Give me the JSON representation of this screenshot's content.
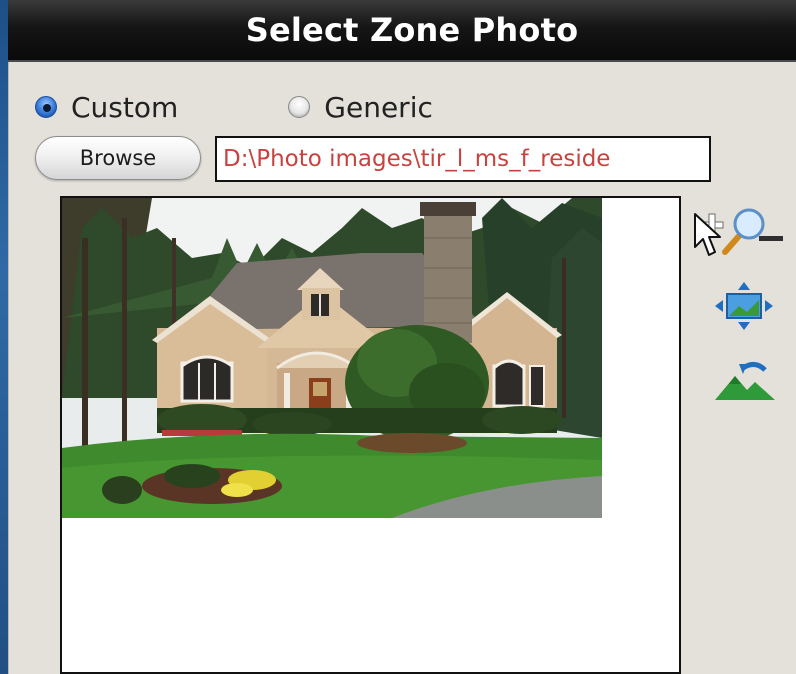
{
  "window": {
    "title": "Select Zone Photo"
  },
  "photo_source": {
    "options": [
      {
        "label": "Custom",
        "selected": true
      },
      {
        "label": "Generic",
        "selected": false
      }
    ]
  },
  "file": {
    "browse_label": "Browse",
    "path_value": "D:\\Photo images\\tir_l_ms_f_reside"
  },
  "preview": {
    "image_description": "house-photo"
  },
  "tools": {
    "zoom_icon": "zoom-in-out-icon",
    "fit_icon": "fit-to-window-icon",
    "reset_icon": "reset-landscape-icon"
  },
  "colors": {
    "title_bar": "#111111",
    "dialog_background": "#e4e1da",
    "path_text": "#c8433f",
    "selected_radio": "#2f6fd0",
    "desktop_background": "#2a5f99"
  }
}
